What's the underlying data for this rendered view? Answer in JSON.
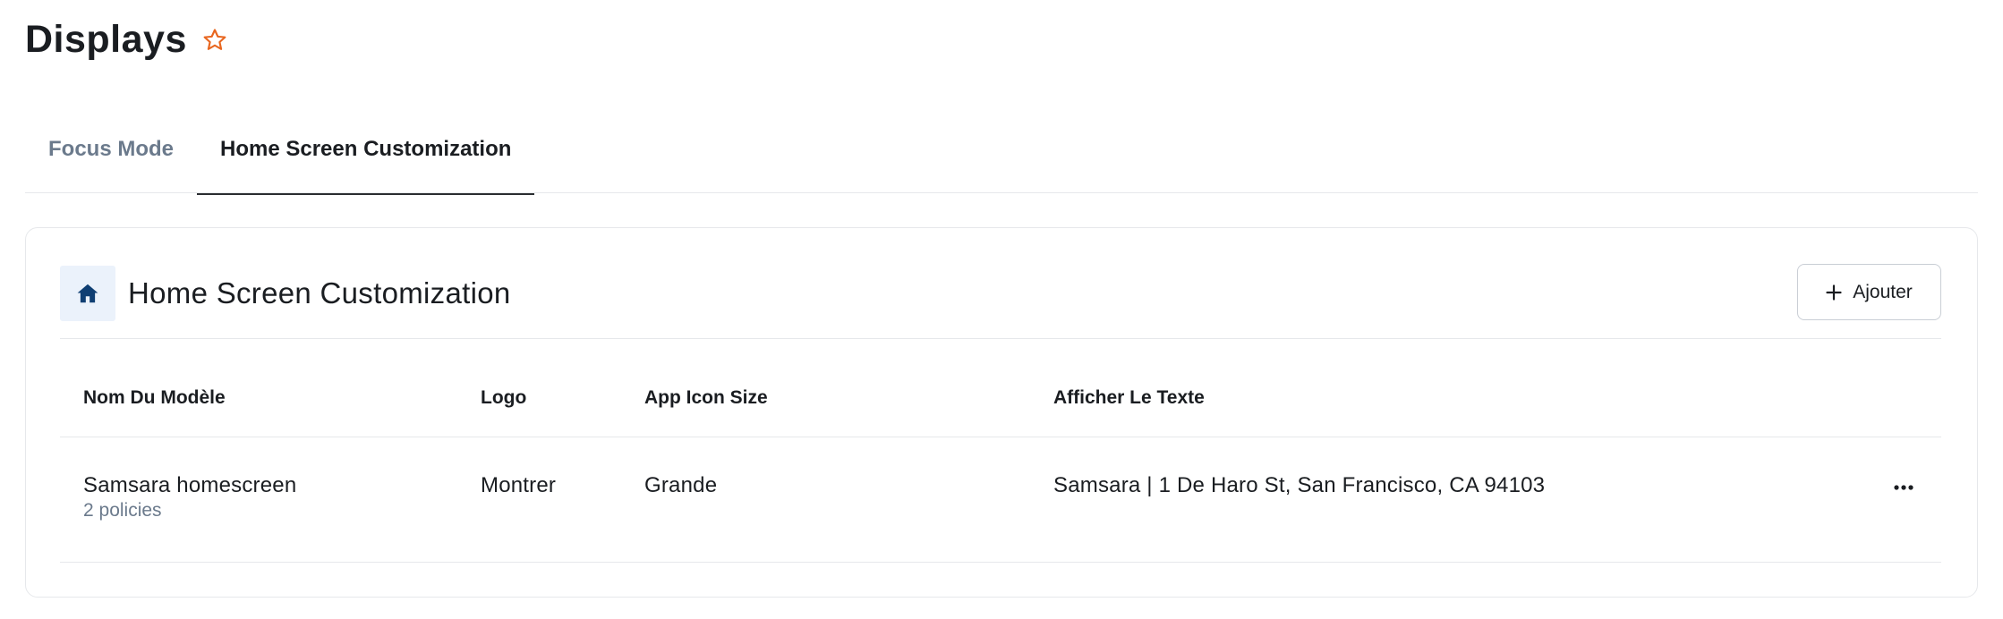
{
  "header": {
    "title": "Displays",
    "favorite_icon": "star-outline-icon",
    "accent_color": "#e8661f"
  },
  "tabs": [
    {
      "label": "Focus Mode",
      "active": false
    },
    {
      "label": "Home Screen Customization",
      "active": true
    }
  ],
  "card": {
    "icon": "home-icon",
    "icon_color": "#0f3f73",
    "title": "Home Screen Customization",
    "add_button": {
      "icon": "plus-icon",
      "label": "Ajouter"
    }
  },
  "table": {
    "columns": [
      "Nom Du Modèle",
      "Logo",
      "App Icon Size",
      "Afficher Le Texte"
    ],
    "rows": [
      {
        "name": "Samsara homescreen",
        "sub": "2 policies",
        "logo": "Montrer",
        "size": "Grande",
        "text": "Samsara | 1 De Haro St, San Francisco, CA 94103",
        "action_icon": "more-horizontal-icon"
      }
    ]
  }
}
